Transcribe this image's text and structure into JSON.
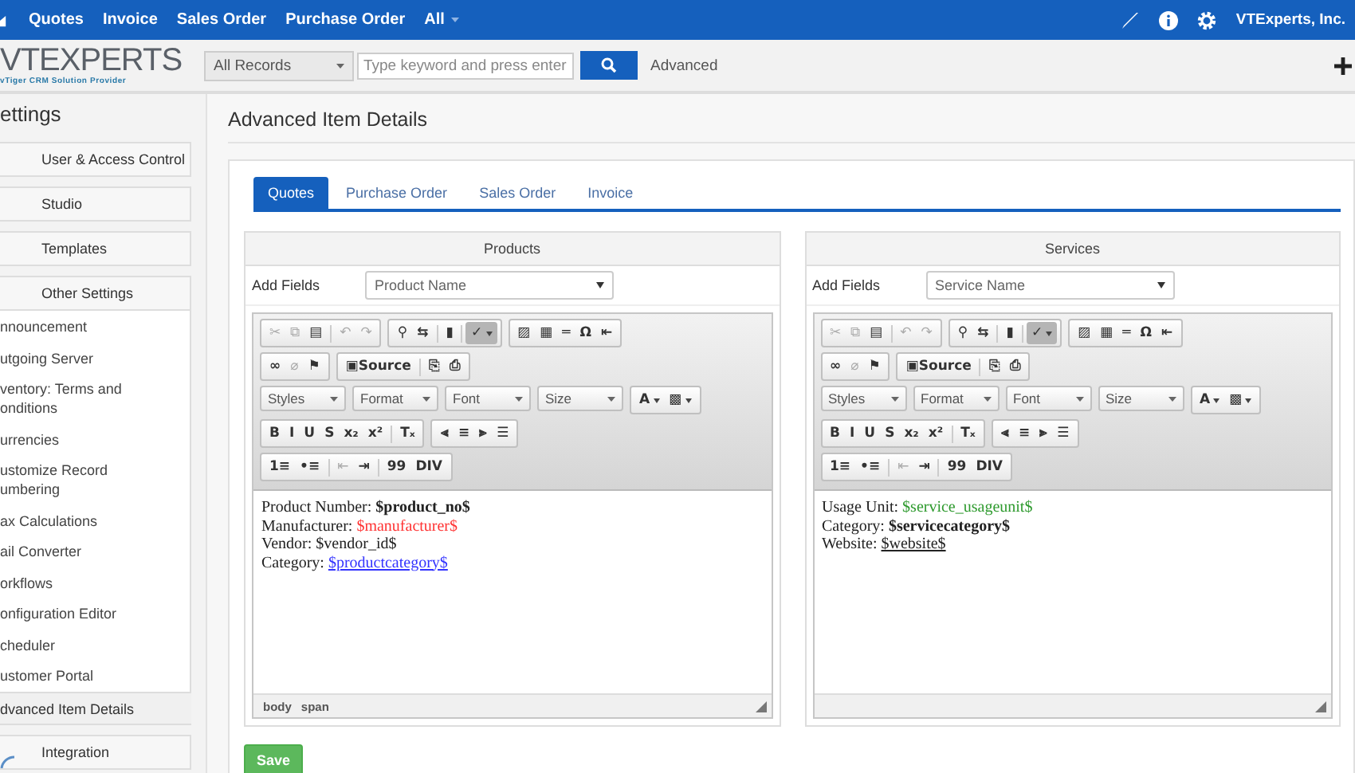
{
  "top_nav": {
    "items": [
      {
        "label": "Quotes",
        "dropdown": false
      },
      {
        "label": "Invoice",
        "dropdown": false
      },
      {
        "label": "Sales Order",
        "dropdown": false
      },
      {
        "label": "Purchase Order",
        "dropdown": false
      },
      {
        "label": "All",
        "dropdown": true
      }
    ],
    "account": "VTExperts, Inc."
  },
  "header": {
    "logo": "VTEXPERTS",
    "logo_tagline": "vTiger CRM Solution Provider",
    "record_filter": "All Records",
    "search_placeholder": "Type keyword and press enter",
    "advanced_link": "Advanced"
  },
  "sidebar": {
    "title": "ettings",
    "sections": [
      {
        "title": "User & Access Control"
      },
      {
        "title": "Studio"
      },
      {
        "title": "Templates"
      },
      {
        "title": "Other Settings",
        "items": [
          {
            "label": "nnouncement",
            "selected": false
          },
          {
            "label": "utgoing Server",
            "selected": false
          },
          {
            "label": "ventory: Terms and onditions",
            "selected": false
          },
          {
            "label": "urrencies",
            "selected": false
          },
          {
            "label": "ustomize Record umbering",
            "selected": false
          },
          {
            "label": "ax Calculations",
            "selected": false
          },
          {
            "label": "ail Converter",
            "selected": false
          },
          {
            "label": "orkflows",
            "selected": false
          },
          {
            "label": "onfiguration Editor",
            "selected": false
          },
          {
            "label": "cheduler",
            "selected": false
          },
          {
            "label": "ustomer Portal",
            "selected": false
          },
          {
            "label": "dvanced Item Details",
            "selected": true
          }
        ]
      },
      {
        "title": "Integration"
      }
    ]
  },
  "page_title": "Advanced Item Details",
  "tabs": [
    {
      "label": "Quotes",
      "selected": true
    },
    {
      "label": "Purchase Order",
      "selected": false
    },
    {
      "label": "Sales Order",
      "selected": false
    },
    {
      "label": "Invoice",
      "selected": false
    }
  ],
  "panels": [
    {
      "title": "Products",
      "add_fields_label": "Add Fields",
      "field_select": "Product Name",
      "toolbar": [
        {
          "kind": "icons",
          "groups": [
            [
              [
                {
                  "glyph": "✂",
                  "disabled": true,
                  "on": false
                },
                {
                  "glyph": "⧉",
                  "disabled": true,
                  "on": false
                },
                {
                  "glyph": "▤",
                  "disabled": false,
                  "on": false
                }
              ],
              [
                {
                  "glyph": "↶",
                  "disabled": true,
                  "on": false
                },
                {
                  "glyph": "↷",
                  "disabled": true,
                  "on": false
                }
              ]
            ],
            [
              [
                {
                  "glyph": "⚲",
                  "disabled": false,
                  "on": false
                },
                {
                  "glyph": "⇆",
                  "disabled": false,
                  "on": false
                }
              ],
              [
                {
                  "glyph": "▮",
                  "disabled": false,
                  "on": false
                }
              ],
              [
                {
                  "glyph": "✓",
                  "disabled": false,
                  "on": true,
                  "menu": true
                }
              ]
            ],
            [
              [
                {
                  "glyph": "▨",
                  "disabled": false,
                  "on": false
                },
                {
                  "glyph": "▦",
                  "disabled": false,
                  "on": false
                },
                {
                  "glyph": "═",
                  "disabled": false,
                  "on": false
                },
                {
                  "glyph": "Ω",
                  "disabled": false,
                  "on": false
                },
                {
                  "glyph": "⇤",
                  "disabled": false,
                  "on": false
                }
              ]
            ]
          ]
        },
        {
          "kind": "icons",
          "groups": [
            [
              [
                {
                  "glyph": "∞",
                  "disabled": false,
                  "on": false
                },
                {
                  "glyph": "⌀",
                  "disabled": true,
                  "on": false
                },
                {
                  "glyph": "⚑",
                  "disabled": false,
                  "on": false
                }
              ]
            ],
            [
              [
                {
                  "glyph": "▣",
                  "label": "Source",
                  "disabled": false,
                  "on": false
                }
              ],
              [
                {
                  "glyph": "⎘",
                  "disabled": false,
                  "on": false
                },
                {
                  "glyph": "⎙",
                  "disabled": false,
                  "on": false
                }
              ]
            ]
          ]
        },
        {
          "kind": "combos",
          "combos": [
            "Styles",
            "Format",
            "Font",
            "Size"
          ],
          "groups": [
            [
              [
                {
                  "glyph": "A",
                  "disabled": false,
                  "on": false,
                  "menu": true
                },
                {
                  "glyph": "▩",
                  "disabled": false,
                  "on": false,
                  "menu": true
                }
              ]
            ]
          ]
        },
        {
          "kind": "icons",
          "groups": [
            [
              [
                {
                  "glyph": "B",
                  "disabled": false,
                  "on": false
                },
                {
                  "glyph": "I",
                  "disabled": false,
                  "on": false
                },
                {
                  "glyph": "U",
                  "disabled": false,
                  "on": false
                },
                {
                  "glyph": "S",
                  "disabled": false,
                  "on": false
                },
                {
                  "glyph": "x₂",
                  "disabled": false,
                  "on": false
                },
                {
                  "glyph": "x²",
                  "disabled": false,
                  "on": false
                }
              ],
              [
                {
                  "glyph": "Tₓ",
                  "disabled": false,
                  "on": false
                }
              ]
            ],
            [
              [
                {
                  "glyph": "⫷",
                  "disabled": false,
                  "on": false
                },
                {
                  "glyph": "≡",
                  "disabled": false,
                  "on": false
                },
                {
                  "glyph": "⫸",
                  "disabled": false,
                  "on": false
                },
                {
                  "glyph": "☰",
                  "disabled": false,
                  "on": false
                }
              ]
            ]
          ]
        },
        {
          "kind": "icons",
          "groups": [
            [
              [
                {
                  "glyph": "1≡",
                  "disabled": false,
                  "on": false
                },
                {
                  "glyph": "•≡",
                  "disabled": false,
                  "on": false
                }
              ],
              [
                {
                  "glyph": "⇤",
                  "disabled": true,
                  "on": false
                },
                {
                  "glyph": "⇥",
                  "disabled": false,
                  "on": false
                }
              ],
              [
                {
                  "glyph": "99",
                  "disabled": false,
                  "on": false
                },
                {
                  "glyph": "DIV",
                  "disabled": false,
                  "on": false
                }
              ]
            ]
          ]
        }
      ],
      "lines": [
        {
          "label": "Product Number: ",
          "value": "$product_no$",
          "kind": "bold"
        },
        {
          "label": "Manufacturer: ",
          "value": "$manufacturer$",
          "kind": "red"
        },
        {
          "label": "Vendor: ",
          "value": "$vendor_id$",
          "kind": "plain"
        },
        {
          "label": "Category: ",
          "value": "$productcategory$",
          "kind": "link"
        }
      ],
      "path": [
        "body",
        "span"
      ]
    },
    {
      "title": "Services",
      "add_fields_label": "Add Fields",
      "field_select": "Service Name",
      "toolbar": [
        {
          "kind": "icons",
          "groups": [
            [
              [
                {
                  "glyph": "✂",
                  "disabled": true,
                  "on": false
                },
                {
                  "glyph": "⧉",
                  "disabled": true,
                  "on": false
                },
                {
                  "glyph": "▤",
                  "disabled": false,
                  "on": false
                }
              ],
              [
                {
                  "glyph": "↶",
                  "disabled": true,
                  "on": false
                },
                {
                  "glyph": "↷",
                  "disabled": true,
                  "on": false
                }
              ]
            ],
            [
              [
                {
                  "glyph": "⚲",
                  "disabled": false,
                  "on": false
                },
                {
                  "glyph": "⇆",
                  "disabled": false,
                  "on": false
                }
              ],
              [
                {
                  "glyph": "▮",
                  "disabled": false,
                  "on": false
                }
              ],
              [
                {
                  "glyph": "✓",
                  "disabled": false,
                  "on": true,
                  "menu": true
                }
              ]
            ],
            [
              [
                {
                  "glyph": "▨",
                  "disabled": false,
                  "on": false
                },
                {
                  "glyph": "▦",
                  "disabled": false,
                  "on": false
                },
                {
                  "glyph": "═",
                  "disabled": false,
                  "on": false
                },
                {
                  "glyph": "Ω",
                  "disabled": false,
                  "on": false
                },
                {
                  "glyph": "⇤",
                  "disabled": false,
                  "on": false
                }
              ]
            ]
          ]
        },
        {
          "kind": "icons",
          "groups": [
            [
              [
                {
                  "glyph": "∞",
                  "disabled": false,
                  "on": false
                },
                {
                  "glyph": "⌀",
                  "disabled": true,
                  "on": false
                },
                {
                  "glyph": "⚑",
                  "disabled": false,
                  "on": false
                }
              ]
            ],
            [
              [
                {
                  "glyph": "▣",
                  "label": "Source",
                  "disabled": false,
                  "on": false
                }
              ],
              [
                {
                  "glyph": "⎘",
                  "disabled": false,
                  "on": false
                },
                {
                  "glyph": "⎙",
                  "disabled": false,
                  "on": false
                }
              ]
            ]
          ]
        },
        {
          "kind": "combos",
          "combos": [
            "Styles",
            "Format",
            "Font",
            "Size"
          ],
          "groups": [
            [
              [
                {
                  "glyph": "A",
                  "disabled": false,
                  "on": false,
                  "menu": true
                },
                {
                  "glyph": "▩",
                  "disabled": false,
                  "on": false,
                  "menu": true
                }
              ]
            ]
          ]
        },
        {
          "kind": "icons",
          "groups": [
            [
              [
                {
                  "glyph": "B",
                  "disabled": false,
                  "on": false
                },
                {
                  "glyph": "I",
                  "disabled": false,
                  "on": false
                },
                {
                  "glyph": "U",
                  "disabled": false,
                  "on": false
                },
                {
                  "glyph": "S",
                  "disabled": false,
                  "on": false
                },
                {
                  "glyph": "x₂",
                  "disabled": false,
                  "on": false
                },
                {
                  "glyph": "x²",
                  "disabled": false,
                  "on": false
                }
              ],
              [
                {
                  "glyph": "Tₓ",
                  "disabled": false,
                  "on": false
                }
              ]
            ],
            [
              [
                {
                  "glyph": "⫷",
                  "disabled": false,
                  "on": false
                },
                {
                  "glyph": "≡",
                  "disabled": false,
                  "on": false
                },
                {
                  "glyph": "⫸",
                  "disabled": false,
                  "on": false
                },
                {
                  "glyph": "☰",
                  "disabled": false,
                  "on": false
                }
              ]
            ]
          ]
        },
        {
          "kind": "icons",
          "groups": [
            [
              [
                {
                  "glyph": "1≡",
                  "disabled": false,
                  "on": false
                },
                {
                  "glyph": "•≡",
                  "disabled": false,
                  "on": false
                }
              ],
              [
                {
                  "glyph": "⇤",
                  "disabled": true,
                  "on": false
                },
                {
                  "glyph": "⇥",
                  "disabled": false,
                  "on": false
                }
              ],
              [
                {
                  "glyph": "99",
                  "disabled": false,
                  "on": false
                },
                {
                  "glyph": "DIV",
                  "disabled": false,
                  "on": false
                }
              ]
            ]
          ]
        }
      ],
      "lines": [
        {
          "label": "Usage Unit: ",
          "value": "$service_usageunit$",
          "kind": "green"
        },
        {
          "label": "Category: ",
          "value": "$servicecategory$",
          "kind": "bold"
        },
        {
          "label": "Website: ",
          "value": "$website$",
          "kind": "underline"
        }
      ]
    }
  ],
  "save_button": "Save"
}
